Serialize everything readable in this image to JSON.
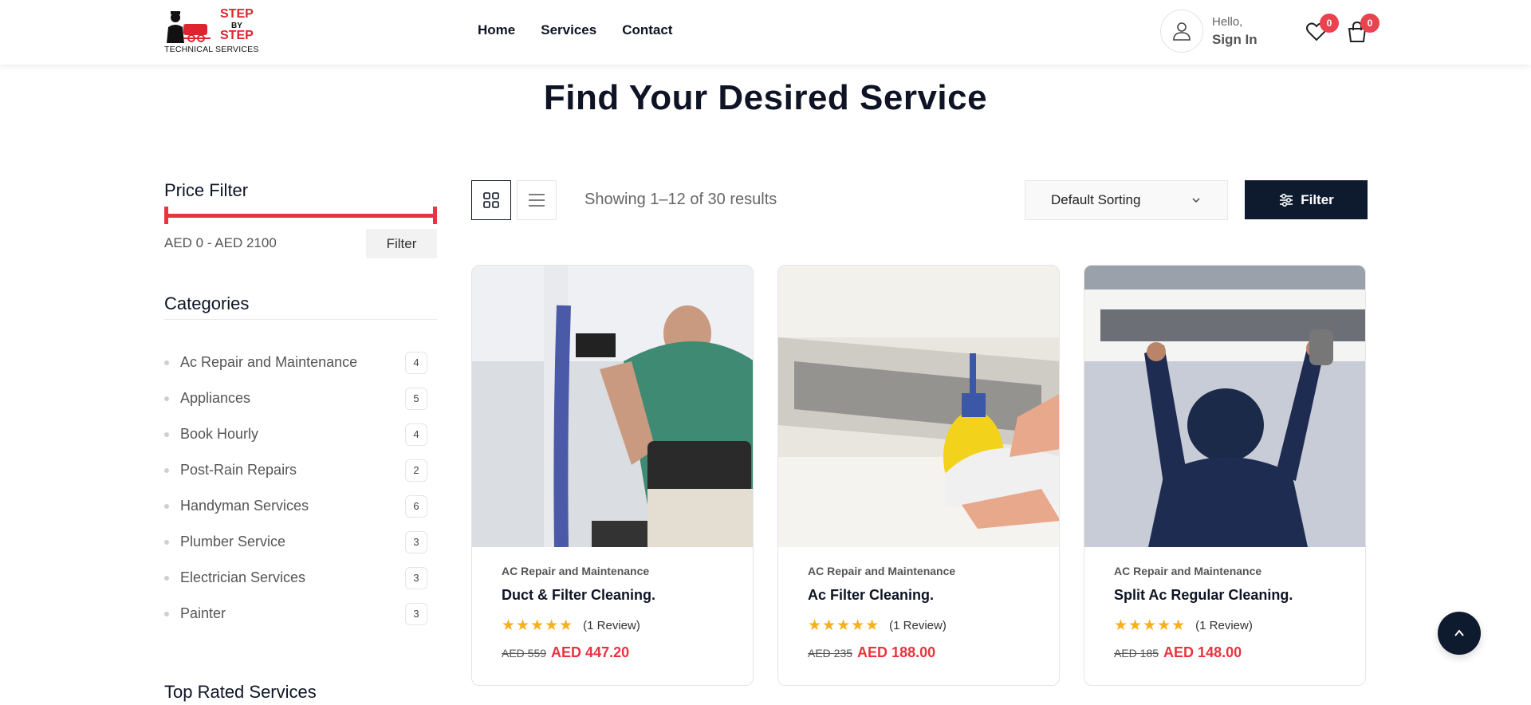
{
  "header": {
    "logo": {
      "line1": "STEP",
      "by": "BY",
      "line2": "STEP",
      "tagline": "TECHNICAL SERVICES"
    },
    "nav": [
      {
        "label": "Home"
      },
      {
        "label": "Services"
      },
      {
        "label": "Contact"
      }
    ],
    "account": {
      "hello": "Hello,",
      "signin": "Sign In"
    },
    "wishlist_count": "0",
    "cart_count": "0"
  },
  "page_title": "Find Your Desired Service",
  "sidebar": {
    "price_filter": {
      "title": "Price Filter",
      "range_text": "AED 0 - AED 2100",
      "button_label": "Filter"
    },
    "categories": {
      "title": "Categories",
      "items": [
        {
          "name": "Ac Repair and Maintenance",
          "count": "4"
        },
        {
          "name": "Appliances",
          "count": "5"
        },
        {
          "name": "Book Hourly",
          "count": "4"
        },
        {
          "name": "Post-Rain Repairs",
          "count": "2"
        },
        {
          "name": "Handyman Services",
          "count": "6"
        },
        {
          "name": "Plumber Service",
          "count": "3"
        },
        {
          "name": "Electrician Services",
          "count": "3"
        },
        {
          "name": "Painter",
          "count": "3"
        }
      ]
    },
    "top_rated_title": "Top Rated Services"
  },
  "toolbar": {
    "results_text": "Showing 1–12 of 30 results",
    "sort_label": "Default Sorting",
    "filter_label": "Filter"
  },
  "products": [
    {
      "category": "AC Repair and Maintenance",
      "title": "Duct & Filter Cleaning.",
      "stars": "★★★★★",
      "reviews": "(1 Review)",
      "old_price": "AED 559",
      "price": "AED 447.20"
    },
    {
      "category": "AC Repair and Maintenance",
      "title": "Ac Filter Cleaning.",
      "stars": "★★★★★",
      "reviews": "(1 Review)",
      "old_price": "AED 235",
      "price": "AED 188.00"
    },
    {
      "category": "AC Repair and Maintenance",
      "title": "Split Ac Regular Cleaning.",
      "stars": "★★★★★",
      "reviews": "(1 Review)",
      "old_price": "AED 185",
      "price": "AED 148.00"
    }
  ],
  "colors": {
    "accent": "#e8343d",
    "navy": "#0e1b2e",
    "star": "#f6b01e"
  }
}
